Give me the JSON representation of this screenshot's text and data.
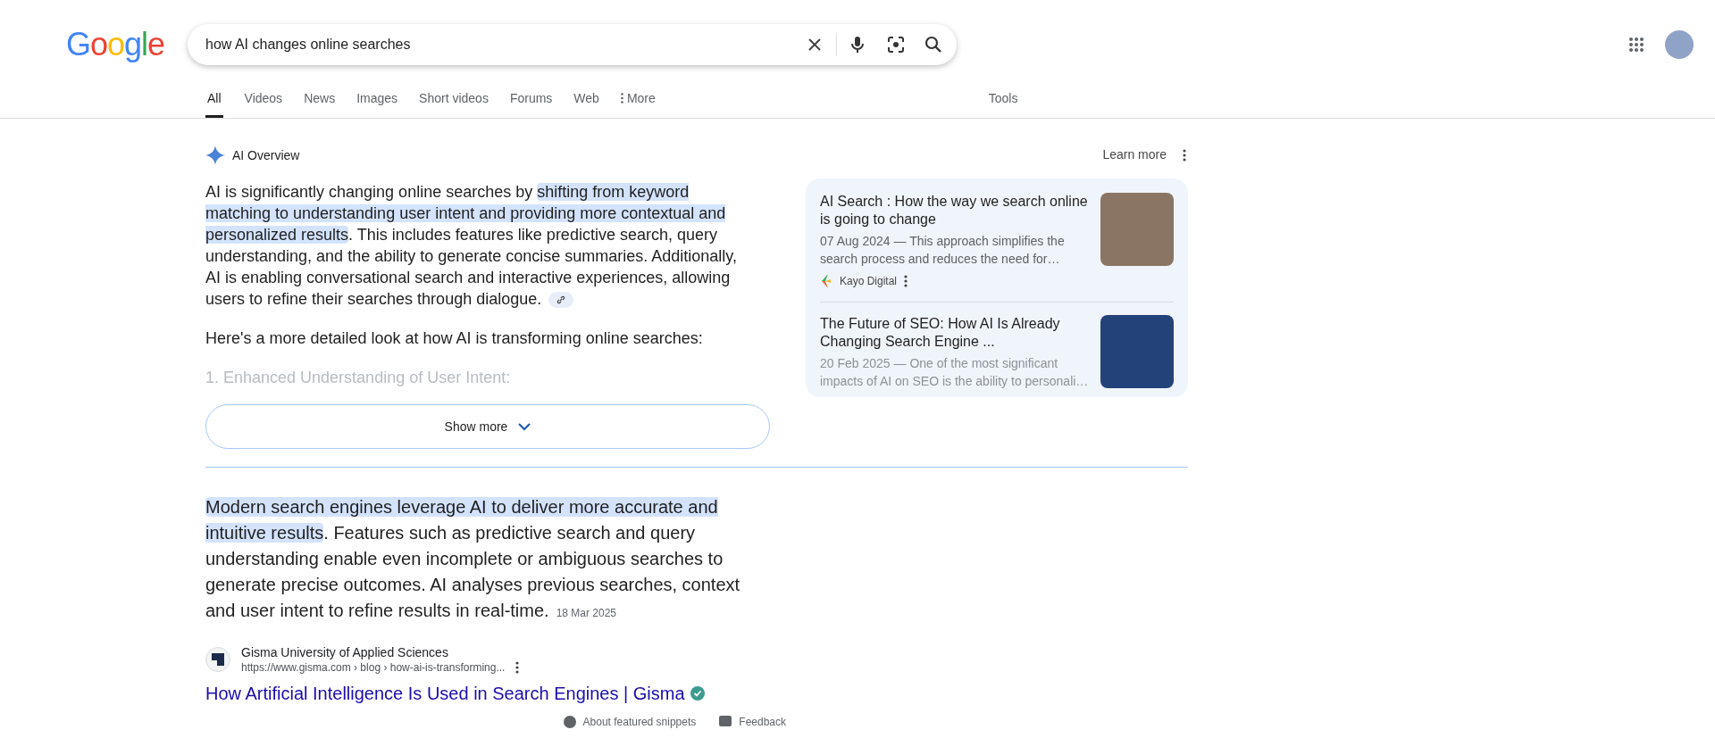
{
  "header": {
    "logo": "Google",
    "query": "how AI changes online searches"
  },
  "tabs": [
    {
      "label": "All",
      "selected": true
    },
    {
      "label": "Videos",
      "selected": false
    },
    {
      "label": "News",
      "selected": false
    },
    {
      "label": "Images",
      "selected": false
    },
    {
      "label": "Short videos",
      "selected": false
    },
    {
      "label": "Forums",
      "selected": false
    },
    {
      "label": "Web",
      "selected": false
    },
    {
      "label": "More",
      "selected": false
    }
  ],
  "tools": "Tools",
  "ai_overview": {
    "title": "AI Overview",
    "learn_more": "Learn more",
    "paragraph": [
      {
        "text": "AI is significantly changing online searches by ",
        "highlighted": false
      },
      {
        "text": "shifting from keyword matching to understanding user intent and providing more contextual and personalized results",
        "highlighted": true
      },
      {
        "text": ". This includes features like predictive search, query understanding, and the ability to generate concise summaries. Additionally, AI is enabling conversational search and interactive experiences, allowing users to refine their searches through dialogue.",
        "highlighted": false
      }
    ],
    "intro": "Here's a more detailed look at how AI is transforming online searches:",
    "faded_heading": "1. Enhanced Understanding of User Intent:",
    "show_more": "Show more",
    "sources": [
      {
        "title": "AI Search : How the way we search online is going to change",
        "snippet": "07 Aug 2024 — This approach simplifies the search process and reduces the need for…",
        "site": "Kayo Digital",
        "faded": false
      },
      {
        "title": "The Future of SEO: How AI Is Already Changing Search Engine ...",
        "snippet": "20 Feb 2025 — One of the most significant impacts of AI on SEO is the ability to personali…",
        "faded": true
      }
    ]
  },
  "featured_snippet": {
    "paragraph": [
      {
        "text": "Modern search engines leverage AI to deliver more accurate and intuitive results",
        "highlighted": true
      },
      {
        "text": ". Features such as predictive search and query understanding enable even incomplete or ambiguous searches to generate precise outcomes. AI analyses previous searches, context and user intent to refine results in real-time.",
        "highlighted": false
      }
    ],
    "date": "18 Mar 2025",
    "site": "Gisma University of Applied Sciences",
    "url": "https://www.gisma.com › blog › how-ai-is-transforming...",
    "link": "How Artificial Intelligence Is Used in Search Engines | Gisma",
    "verified": true,
    "footer": [
      "About featured snippets",
      "Feedback"
    ]
  }
}
